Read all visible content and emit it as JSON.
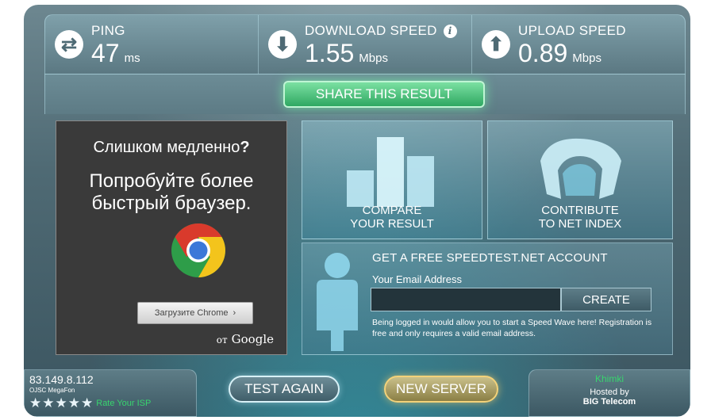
{
  "stats": {
    "ping": {
      "label": "PING",
      "value": "47",
      "unit": "ms",
      "icon": "ping-arrows-icon"
    },
    "download": {
      "label": "DOWNLOAD SPEED",
      "value": "1.55",
      "unit": "Mbps",
      "icon": "download-arrow-icon"
    },
    "upload": {
      "label": "UPLOAD SPEED",
      "value": "0.89",
      "unit": "Mbps",
      "icon": "upload-arrow-icon"
    }
  },
  "share": {
    "label": "SHARE THIS RESULT"
  },
  "ad": {
    "heading": "Слишком медленно",
    "heading_mark": "?",
    "subheading": "Попробуйте более быстрый браузер.",
    "button_label": "Загрузите Chrome",
    "credit_prefix": "от",
    "credit_brand": "Google"
  },
  "tiles": {
    "compare": "COMPARE\nYOUR RESULT",
    "contribute": "CONTRIBUTE\nTO NET INDEX"
  },
  "account": {
    "title": "GET A FREE SPEEDTEST.NET ACCOUNT",
    "email_label": "Your Email Address",
    "email_value": "",
    "create_label": "CREATE",
    "note": "Being logged in would allow you to start a Speed Wave here! Registration is free and only requires a valid email address."
  },
  "isp": {
    "ip": "83.149.8.112",
    "name": "OJSC MegaFon",
    "rating": 5,
    "rate_label": "Rate Your ISP"
  },
  "buttons": {
    "test_again": "TEST AGAIN",
    "new_server": "NEW SERVER"
  },
  "server": {
    "city": "Khimki",
    "hosted_by": "Hosted by",
    "host": "BIG Telecom"
  },
  "colors": {
    "accent_green": "#38d46e",
    "share_green": "#2fa862",
    "server_gold": "#f3d27a"
  }
}
